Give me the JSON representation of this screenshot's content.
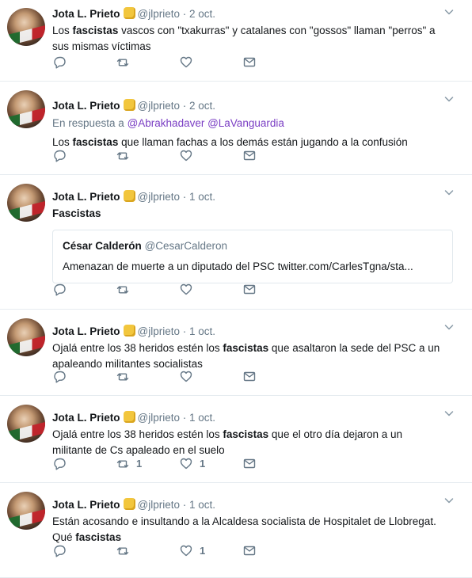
{
  "tweets": [
    {
      "name": "Jota L. Prieto",
      "handle": "@jlprieto",
      "date": "2 oct.",
      "reply_prefix": "",
      "reply_handles": "",
      "text_parts": [
        {
          "t": "Los ",
          "b": false
        },
        {
          "t": "fascistas",
          "b": true
        },
        {
          "t": " vascos con \"txakurras\" y catalanes con \"gossos\" llaman \"perros\" a sus mismas víctimas",
          "b": false
        }
      ],
      "quote": null,
      "retweets": "",
      "likes": ""
    },
    {
      "name": "Jota L. Prieto",
      "handle": "@jlprieto",
      "date": "2 oct.",
      "reply_prefix": "En respuesta a",
      "reply_handles": "@Abrakhadaver @LaVanguardia",
      "text_parts": [
        {
          "t": "Los ",
          "b": false
        },
        {
          "t": "fascistas",
          "b": true
        },
        {
          "t": " que llaman fachas a los demás están jugando a la confusión",
          "b": false
        }
      ],
      "quote": null,
      "retweets": "",
      "likes": ""
    },
    {
      "name": "Jota L. Prieto",
      "handle": "@jlprieto",
      "date": "1 oct.",
      "reply_prefix": "",
      "reply_handles": "",
      "text_parts": [
        {
          "t": "Fascistas",
          "b": true
        }
      ],
      "quote": {
        "name": "César Calderón",
        "handle": "@CesarCalderon",
        "text": "Amenazan de muerte a un diputado del PSC twitter.com/CarlesTgna/sta..."
      },
      "retweets": "",
      "likes": ""
    },
    {
      "name": "Jota L. Prieto",
      "handle": "@jlprieto",
      "date": "1 oct.",
      "reply_prefix": "",
      "reply_handles": "",
      "text_parts": [
        {
          "t": "Ojalá entre los 38 heridos estén los ",
          "b": false
        },
        {
          "t": "fascistas",
          "b": true
        },
        {
          "t": " que asaltaron la sede del PSC a un apaleando militantes socialistas",
          "b": false
        }
      ],
      "quote": null,
      "retweets": "",
      "likes": ""
    },
    {
      "name": "Jota L. Prieto",
      "handle": "@jlprieto",
      "date": "1 oct.",
      "reply_prefix": "",
      "reply_handles": "",
      "text_parts": [
        {
          "t": "Ojalá entre los 38 heridos estén los ",
          "b": false
        },
        {
          "t": "fascistas",
          "b": true
        },
        {
          "t": " que el otro día dejaron a un militante de Cs apaleado en el suelo",
          "b": false
        }
      ],
      "quote": null,
      "retweets": "1",
      "likes": "1"
    },
    {
      "name": "Jota L. Prieto",
      "handle": "@jlprieto",
      "date": "1 oct.",
      "reply_prefix": "",
      "reply_handles": "",
      "text_parts": [
        {
          "t": "Están acosando e insultando a la Alcaldesa socialista de Hospitalet de Llobregat. Qué ",
          "b": false
        },
        {
          "t": "fascistas",
          "b": true
        }
      ],
      "quote": null,
      "retweets": "",
      "likes": "1"
    }
  ],
  "colors": {
    "text": "#14171a",
    "muted": "#657786",
    "border": "#e6ecf0",
    "reply_link": "#7b3fc4",
    "emoji": "#f2c63d"
  },
  "icons": [
    "reply-icon",
    "retweet-icon",
    "like-icon",
    "message-icon",
    "chevron-down-icon",
    "raised-fist-emoji-icon"
  ]
}
